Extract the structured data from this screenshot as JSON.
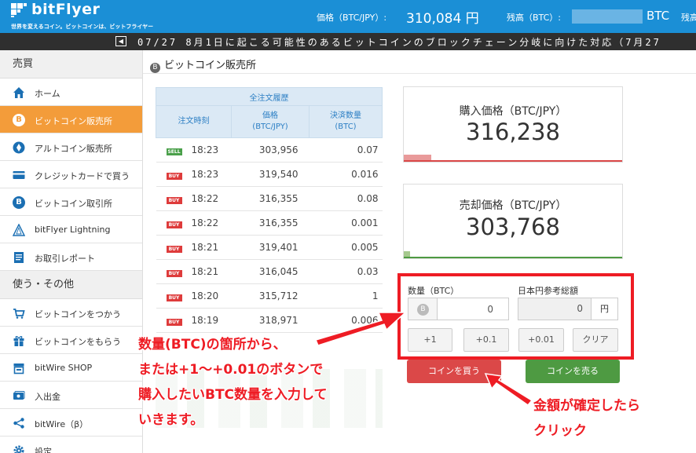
{
  "header": {
    "logo_text": "bitFlyer",
    "logo_sub": "世界を変えるコイン。ビットコインは、ビットフライヤー",
    "price_label": "価格（BTC/JPY）:",
    "price_value": "310,084 円",
    "balance_label": "残高（BTC）:",
    "balance_unit": "BTC",
    "balance_label2": "残高"
  },
  "ticker": {
    "collapse_icon": "◀",
    "text": "07/27 8月1日に起こる可能性のあるビットコインのブロックチェーン分岐に向けた対応（7月27"
  },
  "sidebar": {
    "section1": "売買",
    "items1": [
      {
        "label": "ホーム",
        "icon": "home-icon"
      },
      {
        "label": "ビットコイン販売所",
        "icon": "bitcoin-icon"
      },
      {
        "label": "アルトコイン販売所",
        "icon": "ethereum-icon"
      },
      {
        "label": "クレジットカードで買う",
        "icon": "credit-card-icon"
      },
      {
        "label": "ビットコイン取引所",
        "icon": "bitcoin-icon"
      },
      {
        "label": "bitFlyer Lightning",
        "icon": "lightning-icon"
      },
      {
        "label": "お取引レポート",
        "icon": "report-icon"
      }
    ],
    "section2": "使う・その他",
    "items2": [
      {
        "label": "ビットコインをつかう",
        "icon": "cart-icon"
      },
      {
        "label": "ビットコインをもらう",
        "icon": "gift-icon"
      },
      {
        "label": "bitWire SHOP",
        "icon": "shop-icon"
      },
      {
        "label": "入出金",
        "icon": "deposit-icon"
      },
      {
        "label": "bitWire（β）",
        "icon": "share-icon"
      },
      {
        "label": "設定",
        "icon": "gear-icon"
      }
    ]
  },
  "main": {
    "title": "ビットコイン販売所",
    "history": {
      "caption": "全注文履歴",
      "col_time": "注文時刻",
      "col_price_1": "価格",
      "col_price_2": "(BTC/JPY)",
      "col_amount_1": "決済数量",
      "col_amount_2": "(BTC)",
      "rows": [
        {
          "side": "SELL",
          "time": "18:23",
          "price": "303,956",
          "amount": "0.07"
        },
        {
          "side": "BUY",
          "time": "18:23",
          "price": "319,540",
          "amount": "0.016"
        },
        {
          "side": "BUY",
          "time": "18:22",
          "price": "316,355",
          "amount": "0.08"
        },
        {
          "side": "BUY",
          "time": "18:22",
          "price": "316,355",
          "amount": "0.001"
        },
        {
          "side": "BUY",
          "time": "18:21",
          "price": "319,401",
          "amount": "0.005"
        },
        {
          "side": "BUY",
          "time": "18:21",
          "price": "316,045",
          "amount": "0.03"
        },
        {
          "side": "BUY",
          "time": "18:20",
          "price": "315,712",
          "amount": "1"
        },
        {
          "side": "BUY",
          "time": "18:19",
          "price": "318,971",
          "amount": "0.006"
        }
      ]
    },
    "buy_price": {
      "label": "購入価格（BTC/JPY）",
      "value": "316,238",
      "color": "#db4848"
    },
    "sell_price": {
      "label": "売却価格（BTC/JPY）",
      "value": "303,768",
      "color": "#4e9a42"
    },
    "form": {
      "qty_label": "数量（BTC）",
      "qty_value": "0",
      "jpy_label": "日本円参考総額",
      "jpy_value": "0",
      "jpy_unit": "円",
      "steps": [
        "+1",
        "+0.1",
        "+0.01",
        "クリア"
      ],
      "buy_button": "コインを買う",
      "sell_button": "コインを売る"
    },
    "annotation_left": [
      "数量(BTC)の箇所から、",
      "または+1〜+0.01のボタンで",
      "購入したいBTC数量を入力して",
      "いきます。"
    ],
    "annotation_right": [
      "金額が確定したら",
      "クリック"
    ],
    "annotation_color": "#ee1c24"
  }
}
